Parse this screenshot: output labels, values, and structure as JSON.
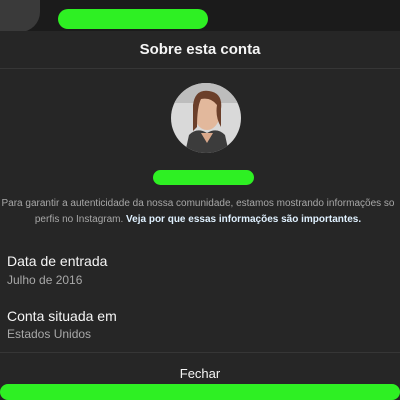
{
  "modal": {
    "title": "Sobre esta conta",
    "info_text": "Para garantir a autenticidade da nossa comunidade, estamos mostrando informações so",
    "info_text_line2": "perfis no Instagram. ",
    "info_link": "Veja por que essas informações são importantes.",
    "rows": [
      {
        "title": "Data de entrada",
        "value": "Julho de 2016"
      },
      {
        "title": "Conta situada em",
        "value": "Estados Unidos"
      }
    ],
    "close_label": "Fechar"
  },
  "colors": {
    "modal_bg": "#262626",
    "link": "#e0f1ff",
    "redaction": "#2ef023"
  }
}
